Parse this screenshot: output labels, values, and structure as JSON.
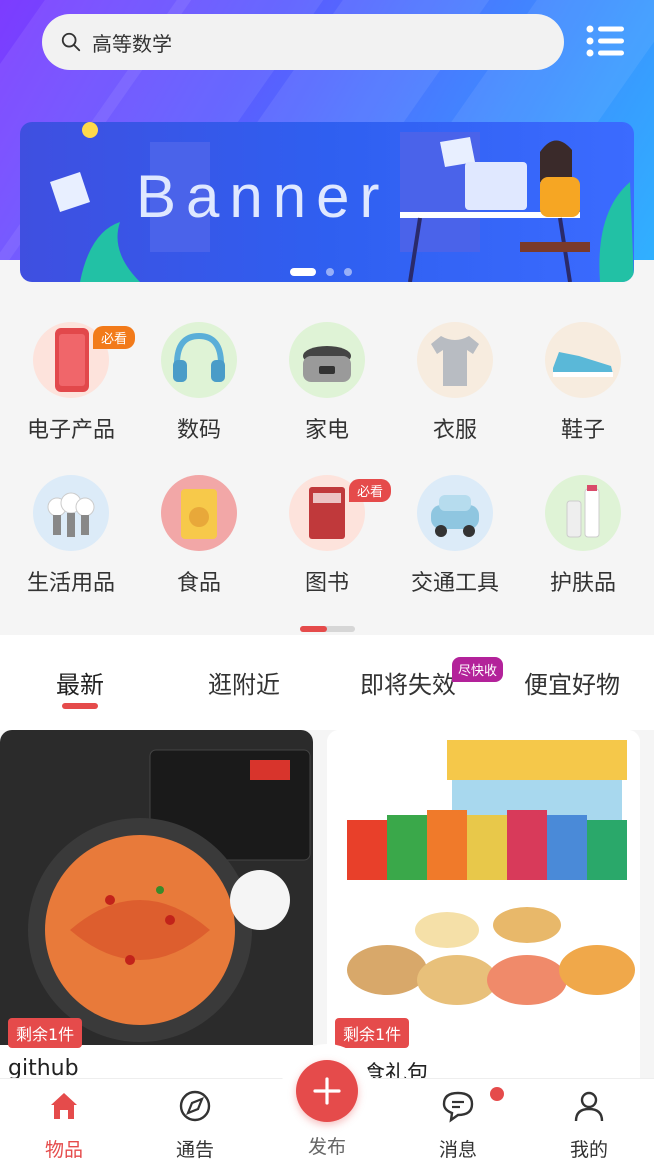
{
  "search": {
    "text": "高等数学",
    "icon": "search-icon"
  },
  "header": {
    "menu_icon": "list-menu-icon"
  },
  "banner": {
    "title": "Banner",
    "page_count": 3,
    "active_index": 0
  },
  "categories": [
    {
      "label": "电子产品",
      "icon": "phone-icon",
      "badge": "必看",
      "badge_color": "#f27a1a"
    },
    {
      "label": "数码",
      "icon": "headphones-icon"
    },
    {
      "label": "家电",
      "icon": "rice-cooker-icon"
    },
    {
      "label": "衣服",
      "icon": "tshirt-icon"
    },
    {
      "label": "鞋子",
      "icon": "sneaker-icon"
    },
    {
      "label": "生活用品",
      "icon": "lightbulb-icon"
    },
    {
      "label": "食品",
      "icon": "snack-icon"
    },
    {
      "label": "图书",
      "icon": "book-icon",
      "badge": "必看",
      "badge_color": "#e54b4b"
    },
    {
      "label": "交通工具",
      "icon": "car-icon"
    },
    {
      "label": "护肤品",
      "icon": "skincare-icon"
    }
  ],
  "category_scroll": {
    "position": 0
  },
  "tabs": [
    {
      "label": "最新",
      "active": true
    },
    {
      "label": "逛附近"
    },
    {
      "label": "即将失效",
      "badge": "尽快收"
    },
    {
      "label": "便宜好物"
    }
  ],
  "products": [
    {
      "stock": "剩余1件",
      "name": "github",
      "image": "spicy-noodles-image"
    },
    {
      "stock": "剩余1件",
      "name": "食礼包",
      "image": "snack-giftbox-image"
    }
  ],
  "nav": {
    "items": [
      {
        "label": "物品",
        "icon": "home-icon",
        "active": true
      },
      {
        "label": "通告",
        "icon": "compass-icon"
      },
      {
        "label": "发布",
        "icon": "plus-icon"
      },
      {
        "label": "消息",
        "icon": "chat-icon",
        "has_dot": true
      },
      {
        "label": "我的",
        "icon": "user-icon"
      }
    ]
  },
  "colors": {
    "accent": "#e54b4b",
    "badge_orange": "#f27a1a",
    "badge_purple": "#b3229a"
  }
}
